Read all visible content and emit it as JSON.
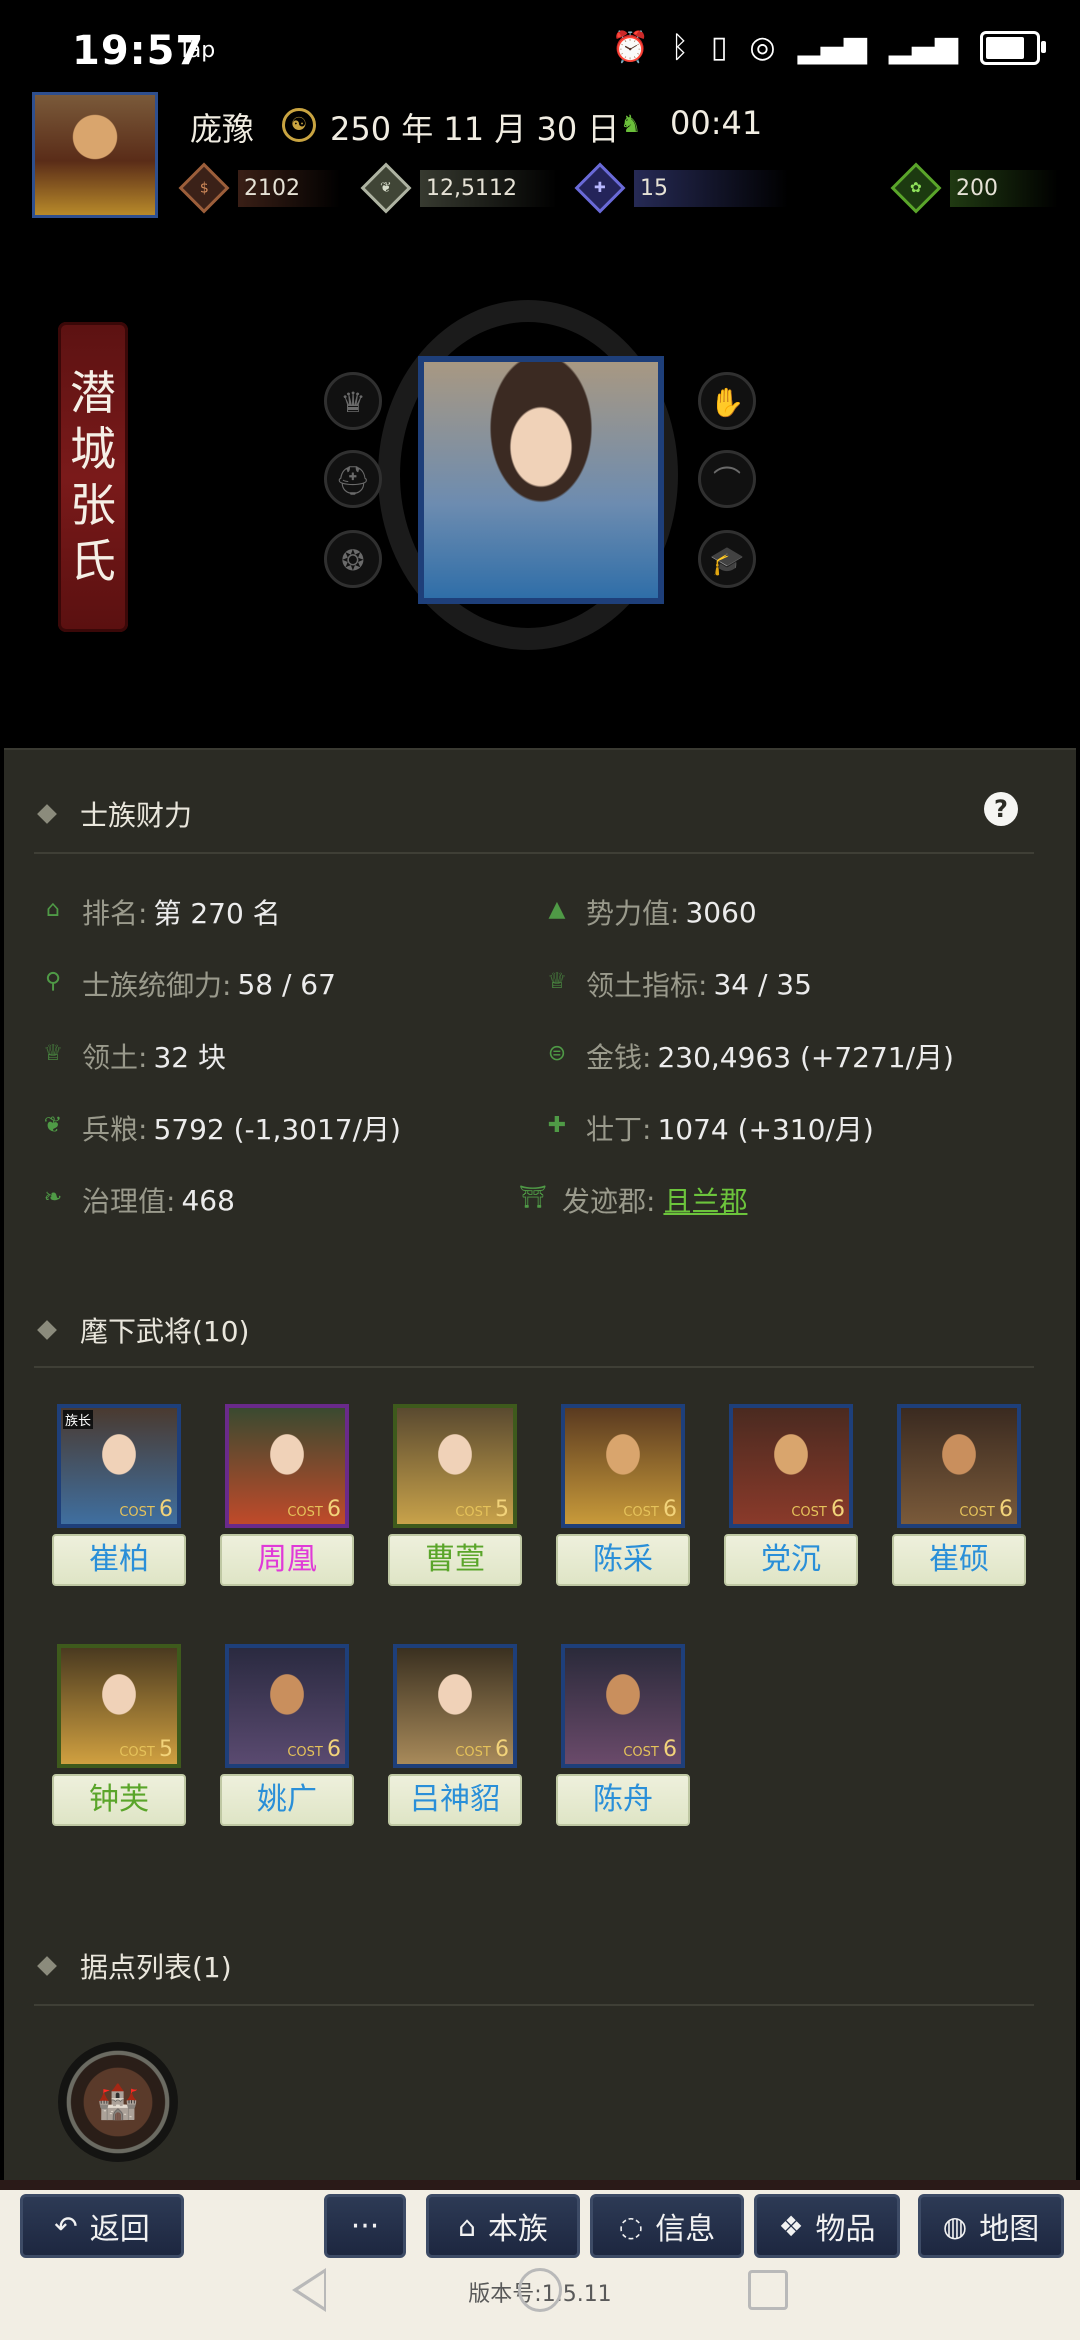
{
  "status_bar": {
    "time": "19:57",
    "tap_label": "Tap",
    "icons": [
      "alarm-icon",
      "bluetooth-icon",
      "vibrate-icon",
      "hotspot-icon",
      "signal-5g-icon",
      "signal-4g-icon",
      "battery-icon"
    ],
    "battery_level": 0.9
  },
  "header": {
    "player_name": "庞豫",
    "date": "250 年 11 月 30 日",
    "time": "00:41",
    "resources": {
      "money": "2102",
      "grain": "12,5112",
      "men": "15",
      "bag": "200"
    }
  },
  "clan": {
    "banner_chars": [
      "潜",
      "城",
      "张",
      "氏"
    ],
    "left_icons": [
      "crown-icon",
      "helmet-icon",
      "clasp-icon"
    ],
    "right_icons": [
      "hand-seed-icon",
      "hat-icon",
      "scholar-cap-icon"
    ]
  },
  "finance": {
    "title": "士族财力",
    "help": "?",
    "stats": {
      "rank_label": "排名:",
      "rank_value": "第 270 名",
      "power_label": "势力值:",
      "power_value": "3060",
      "command_label": "士族统御力:",
      "command_value": "58 / 67",
      "territory_index_label": "领土指标:",
      "territory_index_value": "34 / 35",
      "territory_label": "领土:",
      "territory_value": "32 块",
      "money_label": "金钱:",
      "money_value": "230,4963 (+7271/月)",
      "grain_label": "兵粮:",
      "grain_value": "5792 (-1,3017/月)",
      "men_label": "壮丁:",
      "men_value": "1074 (+310/月)",
      "governance_label": "治理值:",
      "governance_value": "468",
      "origin_label": "发迹郡:",
      "origin_value": "且兰郡"
    }
  },
  "officers": {
    "title": "麾下武将(10)",
    "cost_label": "COST",
    "leader_tag": "族长",
    "list": [
      {
        "name": "崔柏",
        "cost": "6",
        "color": "#2a8fd8"
      },
      {
        "name": "周凰",
        "cost": "6",
        "color": "#e03ad8"
      },
      {
        "name": "曹萱",
        "cost": "5",
        "color": "#5aa52a"
      },
      {
        "name": "陈采",
        "cost": "6",
        "color": "#2a8fd8"
      },
      {
        "name": "党沉",
        "cost": "6",
        "color": "#2a8fd8"
      },
      {
        "name": "崔硕",
        "cost": "6",
        "color": "#2a8fd8"
      },
      {
        "name": "钟芙",
        "cost": "5",
        "color": "#5aa52a"
      },
      {
        "name": "姚广",
        "cost": "6",
        "color": "#2a8fd8"
      },
      {
        "name": "吕神貂",
        "cost": "6",
        "color": "#2a8fd8"
      },
      {
        "name": "陈舟",
        "cost": "6",
        "color": "#2a8fd8"
      }
    ]
  },
  "strongholds": {
    "title": "据点列表(1)"
  },
  "bottom_nav": {
    "back": "返回",
    "more": "···",
    "clan": "本族",
    "info": "信息",
    "items": "物品",
    "map": "地图"
  },
  "version": "版本号:1.5.11"
}
